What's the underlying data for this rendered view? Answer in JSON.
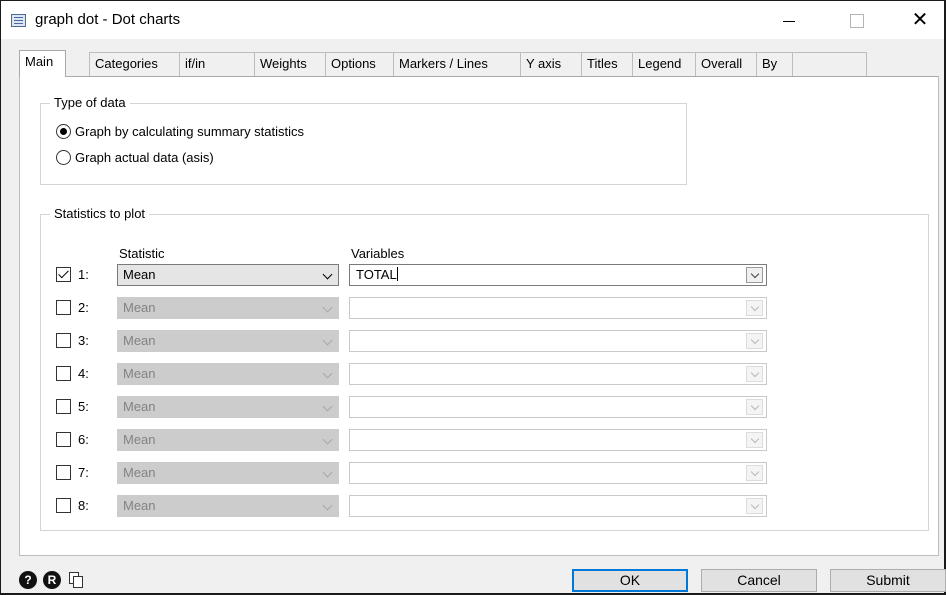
{
  "window": {
    "title": "graph dot - Dot charts",
    "minimize": "—",
    "close": "✕"
  },
  "tabs": [
    "Main",
    "Categories",
    "if/in",
    "Weights",
    "Options",
    "Markers / Lines",
    "Y axis",
    "Titles",
    "Legend",
    "Overall",
    "By"
  ],
  "active_tab": "Main",
  "type_of_data": {
    "label": "Type of data",
    "options": [
      {
        "label": "Graph by calculating summary statistics",
        "selected": true
      },
      {
        "label": "Graph actual data (asis)",
        "selected": false
      }
    ]
  },
  "statistics": {
    "label": "Statistics to plot",
    "statistic_header": "Statistic",
    "variables_header": "Variables",
    "rows": [
      {
        "num": "1:",
        "checked": true,
        "statistic": "Mean",
        "variables": "TOTAL",
        "enabled": true
      },
      {
        "num": "2:",
        "checked": false,
        "statistic": "Mean",
        "variables": "",
        "enabled": false
      },
      {
        "num": "3:",
        "checked": false,
        "statistic": "Mean",
        "variables": "",
        "enabled": false
      },
      {
        "num": "4:",
        "checked": false,
        "statistic": "Mean",
        "variables": "",
        "enabled": false
      },
      {
        "num": "5:",
        "checked": false,
        "statistic": "Mean",
        "variables": "",
        "enabled": false
      },
      {
        "num": "6:",
        "checked": false,
        "statistic": "Mean",
        "variables": "",
        "enabled": false
      },
      {
        "num": "7:",
        "checked": false,
        "statistic": "Mean",
        "variables": "",
        "enabled": false
      },
      {
        "num": "8:",
        "checked": false,
        "statistic": "Mean",
        "variables": "",
        "enabled": false
      }
    ]
  },
  "bottom": {
    "help_icon": "?",
    "reset_icon": "R",
    "ok": "OK",
    "cancel": "Cancel",
    "submit": "Submit"
  },
  "colors": {
    "default_button_border": "#0078d7",
    "disabled_field": "#cccccc"
  }
}
